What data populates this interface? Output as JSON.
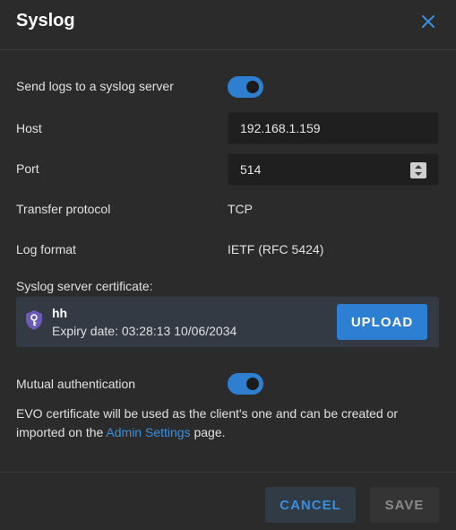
{
  "dialog": {
    "title": "Syslog"
  },
  "fields": {
    "send_logs_label": "Send logs to a syslog server",
    "send_logs_enabled": true,
    "host_label": "Host",
    "host_value": "192.168.1.159",
    "port_label": "Port",
    "port_value": "514",
    "protocol_label": "Transfer protocol",
    "protocol_value": "TCP",
    "format_label": "Log format",
    "format_value": "IETF (RFC 5424)"
  },
  "certificate": {
    "label": "Syslog server certificate:",
    "name": "hh",
    "expiry": "Expiry date: 03:28:13 10/06/2034",
    "upload_label": "UPLOAD",
    "icon": "shield-key-icon",
    "icon_color": "#6b5bb8"
  },
  "mutual": {
    "label": "Mutual authentication",
    "enabled": true
  },
  "note": {
    "text_before": "EVO certificate will be used as the client's one and can be created or imported on the ",
    "link_text": "Admin Settings",
    "text_after": " page."
  },
  "footer": {
    "cancel_label": "CANCEL",
    "save_label": "SAVE"
  },
  "colors": {
    "accent": "#2d7fd3",
    "background": "#2b2b2b"
  }
}
